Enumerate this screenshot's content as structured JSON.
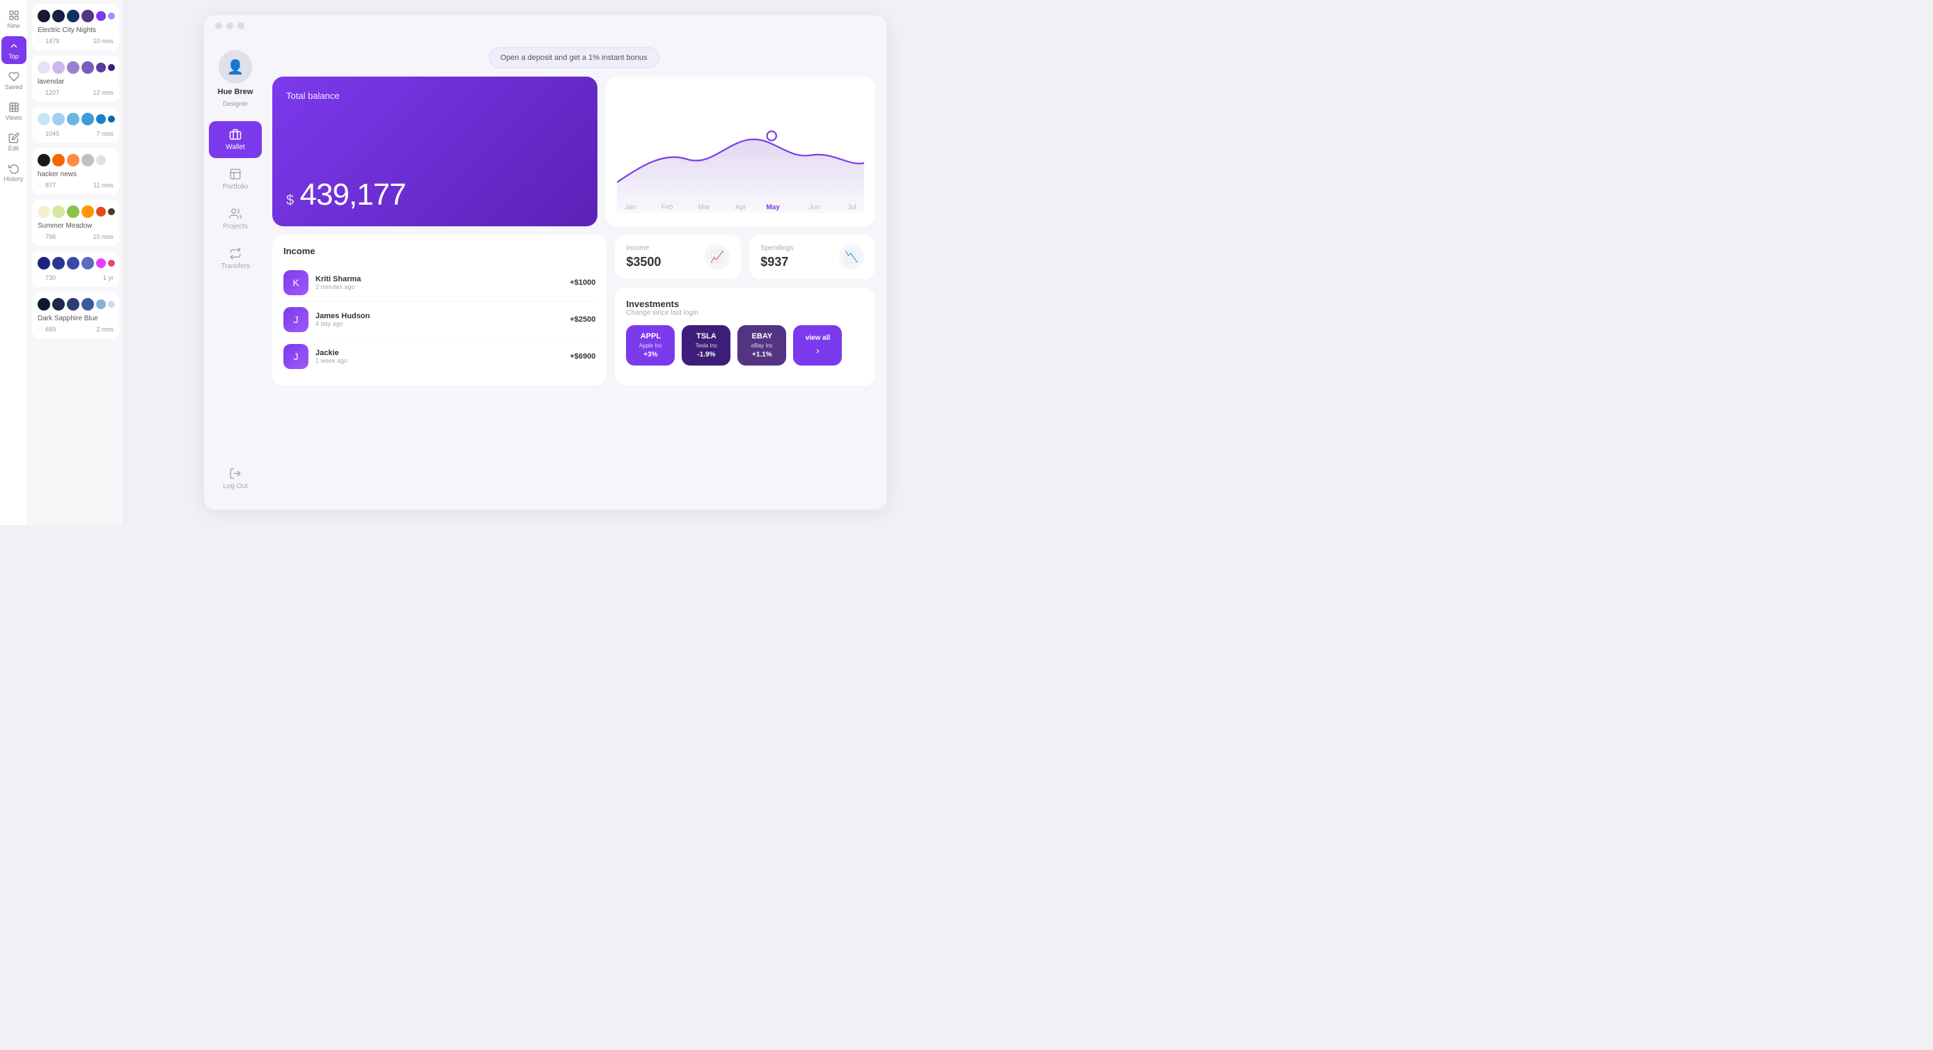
{
  "iconNav": {
    "items": [
      {
        "id": "new",
        "label": "New",
        "icon": "⊞",
        "active": false
      },
      {
        "id": "top",
        "label": "Top",
        "icon": "↑",
        "active": true
      },
      {
        "id": "saved",
        "label": "Saved",
        "icon": "♡",
        "active": false
      },
      {
        "id": "views",
        "label": "Views",
        "icon": "▣",
        "active": false
      },
      {
        "id": "edit",
        "label": "Edit",
        "icon": "✎",
        "active": false
      },
      {
        "id": "history",
        "label": "History",
        "icon": "↺",
        "active": false
      }
    ]
  },
  "palettes": [
    {
      "id": "electric-city-nights",
      "name": "Electric City Nights",
      "likes": "1479",
      "age": "10 mos",
      "swatches": [
        "#1a1a2e",
        "#16213e",
        "#0f3460",
        "#533483",
        "#7c3aed",
        "#a78bfa"
      ]
    },
    {
      "id": "lavendar",
      "name": "lavendar",
      "likes": "1207",
      "age": "12 mos",
      "swatches": [
        "#e8e0f5",
        "#c9b8e8",
        "#9b7fce",
        "#7c5cbf",
        "#5c3a9e",
        "#3d1f7a"
      ]
    },
    {
      "id": "palette3",
      "name": "",
      "likes": "1045",
      "age": "7 mos",
      "swatches": [
        "#c8e6f7",
        "#9fd0ed",
        "#6bb5e3",
        "#3d9cd9",
        "#1a82c9",
        "#0066b2"
      ]
    },
    {
      "id": "hacker-news",
      "name": "hacker news",
      "likes": "877",
      "age": "11 mos",
      "swatches": [
        "#1a1a1a",
        "#f56500",
        "#ff8c42",
        "#c0c0c0",
        "#e0e0e0"
      ]
    },
    {
      "id": "summer-meadow",
      "name": "Summer Meadow",
      "likes": "796",
      "age": "10 mos",
      "swatches": [
        "#f5f0d0",
        "#d4e8a0",
        "#8bc34a",
        "#ff9800",
        "#e64a19",
        "#4e342e"
      ]
    },
    {
      "id": "palette6",
      "name": "",
      "likes": "730",
      "age": "1 yr",
      "swatches": [
        "#1a237e",
        "#283593",
        "#3949ab",
        "#5c6bc0",
        "#e040fb",
        "#ec407a"
      ]
    },
    {
      "id": "dark-sapphire-blue",
      "name": "Dark Sapphire Blue",
      "likes": "689",
      "age": "2 mos",
      "swatches": [
        "#0d1b2a",
        "#1b2a4a",
        "#2a3f6f",
        "#3a5a9e",
        "#8ab0d0",
        "#c5ddf5"
      ]
    }
  ],
  "dashboard": {
    "windowDots": [
      "#ddd",
      "#ddd",
      "#ddd"
    ],
    "profile": {
      "name": "Hue Brew",
      "role": "Designer",
      "avatar": "👤"
    },
    "nav": {
      "items": [
        {
          "id": "wallet",
          "label": "Wallet",
          "active": true
        },
        {
          "id": "portfolio",
          "label": "Portfolio",
          "active": false
        },
        {
          "id": "projects",
          "label": "Projects",
          "active": false
        },
        {
          "id": "transfers",
          "label": "Transfers",
          "active": false
        }
      ],
      "logoutLabel": "Log Out"
    },
    "bonusBanner": "Open a deposit and get a 1% instant bonus",
    "balance": {
      "label": "Total balance",
      "currency": "$",
      "amount": "439,177"
    },
    "income": {
      "title": "Income",
      "items": [
        {
          "name": "Kriti Sharma",
          "time": "2 minutes ago",
          "amount": "+$1000",
          "initial": "K"
        },
        {
          "name": "James Hudson",
          "time": "4 day ago",
          "amount": "+$2500",
          "initial": "J"
        },
        {
          "name": "Jackie",
          "time": "1 week ago",
          "amount": "+$6900",
          "initial": "J"
        }
      ]
    },
    "chart": {
      "months": [
        "Jan",
        "Feb",
        "Mar",
        "Apr",
        "May",
        "Jun",
        "Jul"
      ],
      "activeMonth": "May"
    },
    "summary": {
      "income": {
        "label": "Income",
        "value": "$3500"
      },
      "spendings": {
        "label": "Spendings",
        "value": "$937"
      }
    },
    "investments": {
      "title": "Investments",
      "subtitle": "Change since last login",
      "items": [
        {
          "ticker": "APPL",
          "name": "Apple Inc",
          "change": "+3%",
          "style": "purple"
        },
        {
          "ticker": "TSLA",
          "name": "Tesla Inc",
          "change": "-1.9%",
          "style": "dark"
        },
        {
          "ticker": "EBAY",
          "name": "eBay Inc",
          "change": "+1.1%",
          "style": "medium"
        }
      ],
      "viewAllLabel": "view all"
    }
  }
}
